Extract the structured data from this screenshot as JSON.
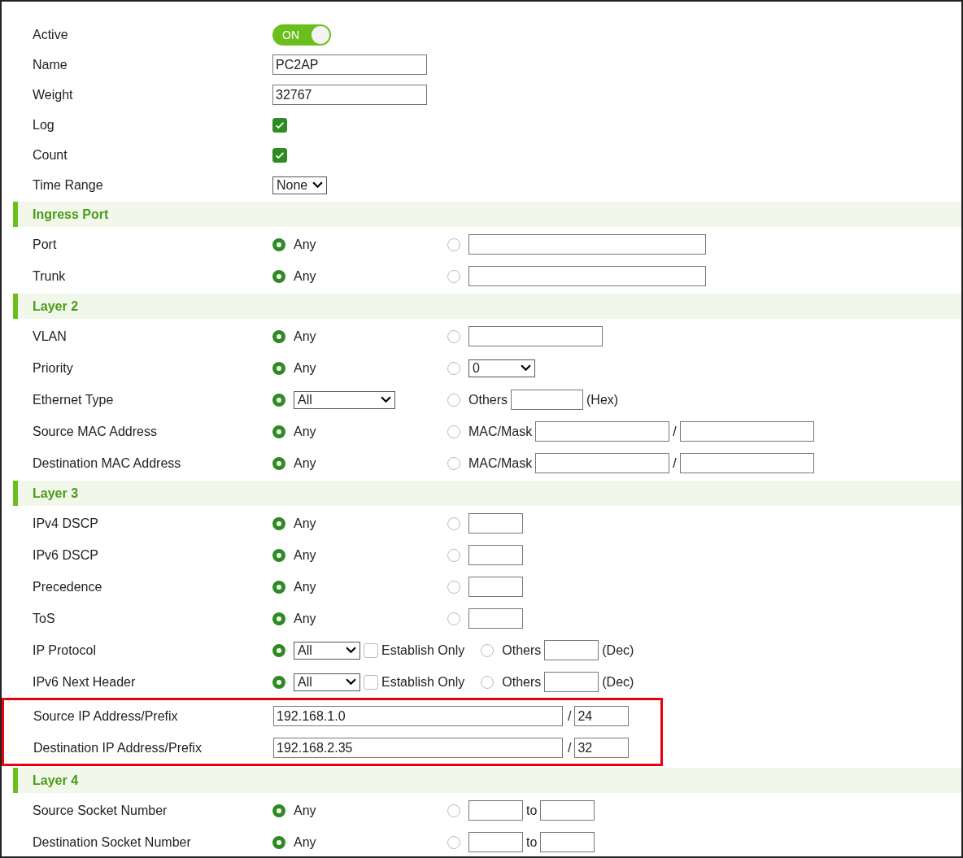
{
  "general": [
    {
      "kind": "toggle",
      "label": "Active",
      "on": true,
      "text": "ON"
    },
    {
      "kind": "text",
      "label": "Name",
      "value": "PC2AP"
    },
    {
      "kind": "text",
      "label": "Weight",
      "value": "32767"
    },
    {
      "kind": "check",
      "label": "Log",
      "checked": true
    },
    {
      "kind": "check",
      "label": "Count",
      "checked": true
    },
    {
      "kind": "select",
      "label": "Time Range",
      "value": "None"
    }
  ],
  "sections": [
    {
      "title": "Ingress Port",
      "items": [
        {
          "label": "Port",
          "choices": [
            {
              "selected": true,
              "parts": [
                {
                  "kind": "text",
                  "text": "Any"
                }
              ]
            },
            {
              "selected": false,
              "parts": [
                {
                  "kind": "longfield"
                }
              ]
            }
          ]
        },
        {
          "label": "Trunk",
          "choices": [
            {
              "selected": true,
              "parts": [
                {
                  "kind": "text",
                  "text": "Any"
                }
              ]
            },
            {
              "selected": false,
              "parts": [
                {
                  "kind": "longfield"
                }
              ]
            }
          ]
        }
      ]
    },
    {
      "title": "Layer 2",
      "items": [
        {
          "label": "VLAN",
          "choices": [
            {
              "selected": true,
              "parts": [
                {
                  "kind": "text",
                  "text": "Any"
                }
              ]
            },
            {
              "selected": false,
              "parts": [
                {
                  "kind": "field"
                }
              ]
            }
          ]
        },
        {
          "label": "Priority",
          "choices": [
            {
              "selected": true,
              "parts": [
                {
                  "kind": "text",
                  "text": "Any"
                }
              ]
            },
            {
              "selected": false,
              "parts": [
                {
                  "kind": "select",
                  "value": "0"
                }
              ]
            }
          ]
        },
        {
          "label": "Ethernet Type",
          "choices": [
            {
              "selected": true,
              "parts": [
                {
                  "kind": "wideselect",
                  "value": "All"
                }
              ]
            },
            {
              "selected": false,
              "parts": [
                {
                  "kind": "text",
                  "text": "Others"
                },
                {
                  "kind": "shortfield"
                },
                {
                  "kind": "text",
                  "text": "(Hex)"
                }
              ]
            }
          ]
        },
        {
          "label": "Source MAC Address",
          "choices": [
            {
              "selected": true,
              "parts": [
                {
                  "kind": "text",
                  "text": "Any"
                }
              ]
            },
            {
              "selected": false,
              "parts": [
                {
                  "kind": "text",
                  "text": "MAC/Mask"
                },
                {
                  "kind": "field"
                },
                {
                  "kind": "text",
                  "text": "/"
                },
                {
                  "kind": "field"
                }
              ]
            }
          ]
        },
        {
          "label": "Destination MAC Address",
          "choices": [
            {
              "selected": true,
              "parts": [
                {
                  "kind": "text",
                  "text": "Any"
                }
              ]
            },
            {
              "selected": false,
              "parts": [
                {
                  "kind": "text",
                  "text": "MAC/Mask"
                },
                {
                  "kind": "field"
                },
                {
                  "kind": "text",
                  "text": "/"
                },
                {
                  "kind": "field"
                }
              ]
            }
          ]
        }
      ]
    },
    {
      "title": "Layer 3",
      "items": [
        {
          "label": "IPv4 DSCP",
          "choices": [
            {
              "selected": true,
              "parts": [
                {
                  "kind": "text",
                  "text": "Any"
                }
              ]
            },
            {
              "selected": false,
              "parts": [
                {
                  "kind": "tinyfield"
                }
              ]
            }
          ]
        },
        {
          "label": "IPv6 DSCP",
          "choices": [
            {
              "selected": true,
              "parts": [
                {
                  "kind": "text",
                  "text": "Any"
                }
              ]
            },
            {
              "selected": false,
              "parts": [
                {
                  "kind": "tinyfield"
                }
              ]
            }
          ]
        },
        {
          "label": "Precedence",
          "choices": [
            {
              "selected": true,
              "parts": [
                {
                  "kind": "text",
                  "text": "Any"
                }
              ]
            },
            {
              "selected": false,
              "parts": [
                {
                  "kind": "tinyfield"
                }
              ]
            }
          ]
        },
        {
          "label": "ToS",
          "choices": [
            {
              "selected": true,
              "parts": [
                {
                  "kind": "text",
                  "text": "Any"
                }
              ]
            },
            {
              "selected": false,
              "parts": [
                {
                  "kind": "tinyfield"
                }
              ]
            }
          ]
        },
        {
          "label": "IP Protocol",
          "choices": [
            {
              "selected": true,
              "parts": [
                {
                  "kind": "select",
                  "value": "All"
                },
                {
                  "kind": "check",
                  "checked": false
                },
                {
                  "kind": "text",
                  "text": "Establish Only"
                }
              ]
            },
            {
              "selected": false,
              "parts": [
                {
                  "kind": "text",
                  "text": "Others"
                },
                {
                  "kind": "tinyfield"
                },
                {
                  "kind": "text",
                  "text": "(Dec)"
                }
              ]
            }
          ]
        },
        {
          "label": "IPv6 Next Header",
          "choices": [
            {
              "selected": true,
              "parts": [
                {
                  "kind": "select",
                  "value": "All"
                },
                {
                  "kind": "check",
                  "checked": false
                },
                {
                  "kind": "text",
                  "text": "Establish Only"
                }
              ]
            },
            {
              "selected": false,
              "parts": [
                {
                  "kind": "text",
                  "text": "Others"
                },
                {
                  "kind": "tinyfield"
                },
                {
                  "kind": "text",
                  "text": "(Dec)"
                }
              ]
            }
          ]
        },
        {
          "highlighted": true,
          "rows": [
            {
              "label": "Source IP Address/Prefix",
              "parts": [
                {
                  "kind": "ipfield",
                  "value": "192.168.1.0"
                },
                {
                  "kind": "text",
                  "text": "/"
                },
                {
                  "kind": "tinyfield",
                  "value": "24"
                }
              ]
            },
            {
              "label": "Destination IP Address/Prefix",
              "parts": [
                {
                  "kind": "ipfield",
                  "value": "192.168.2.35"
                },
                {
                  "kind": "text",
                  "text": "/"
                },
                {
                  "kind": "tinyfield",
                  "value": "32"
                }
              ]
            }
          ]
        }
      ]
    },
    {
      "title": "Layer 4",
      "items": [
        {
          "label": "Source Socket Number",
          "choices": [
            {
              "selected": true,
              "parts": [
                {
                  "kind": "text",
                  "text": "Any"
                }
              ]
            },
            {
              "selected": false,
              "parts": [
                {
                  "kind": "tinyfield"
                },
                {
                  "kind": "text",
                  "text": "to"
                },
                {
                  "kind": "tinyfield"
                }
              ]
            }
          ]
        },
        {
          "label": "Destination Socket Number",
          "choices": [
            {
              "selected": true,
              "parts": [
                {
                  "kind": "text",
                  "text": "Any"
                }
              ]
            },
            {
              "selected": false,
              "parts": [
                {
                  "kind": "tinyfield"
                },
                {
                  "kind": "text",
                  "text": "to"
                },
                {
                  "kind": "tinyfield"
                }
              ]
            }
          ]
        }
      ]
    }
  ]
}
